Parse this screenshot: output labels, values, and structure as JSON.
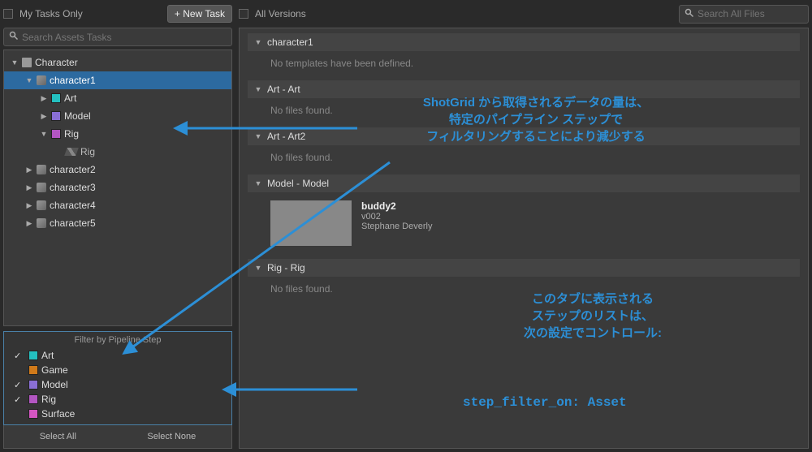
{
  "left": {
    "my_tasks_label": "My Tasks Only",
    "new_task_label": "+ New Task",
    "search_placeholder": "Search Assets Tasks",
    "tree": {
      "root_label": "Character",
      "char1": "character1",
      "art": "Art",
      "model": "Model",
      "rig": "Rig",
      "rig_task": "Rig",
      "char2": "character2",
      "char3": "character3",
      "char4": "character4",
      "char5": "character5"
    },
    "filter_title": "Filter by Pipeline Step",
    "filters": [
      {
        "name": "Art",
        "checked": true,
        "color": "#24c0c0"
      },
      {
        "name": "Game",
        "checked": false,
        "color": "#d07a1a"
      },
      {
        "name": "Model",
        "checked": true,
        "color": "#8a6fd6"
      },
      {
        "name": "Rig",
        "checked": true,
        "color": "#b356c2"
      },
      {
        "name": "Surface",
        "checked": false,
        "color": "#d456c2"
      }
    ],
    "select_all": "Select All",
    "select_none": "Select None"
  },
  "right": {
    "all_versions_label": "All Versions",
    "search_placeholder": "Search All Files",
    "sections": {
      "s1": {
        "title": "character1",
        "msg": "No templates have been defined."
      },
      "s2": {
        "title": "Art - Art",
        "msg": "No files found."
      },
      "s3": {
        "title": "Art - Art2",
        "msg": "No files found."
      },
      "s4": {
        "title": "Model - Model"
      },
      "asset": {
        "name": "buddy2",
        "ver": "v002",
        "author": "Stephane Deverly"
      },
      "s5": {
        "title": "Rig - Rig",
        "msg": "No files found."
      }
    }
  },
  "annotations": {
    "top_line1": "ShotGrid から取得されるデータの量は、",
    "top_line2": "特定のパイプライン ステップで",
    "top_line3": "フィルタリングすることにより減少する",
    "mid_line1": "このタブに表示される",
    "mid_line2": "ステップのリストは、",
    "mid_line3": "次の設定でコントロール:",
    "code": "step_filter_on: Asset"
  },
  "colors": {
    "art": "#24c0c0",
    "model": "#8a6fd6",
    "rig": "#b356c2"
  }
}
